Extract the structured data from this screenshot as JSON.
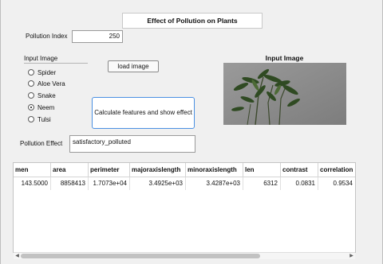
{
  "title": "Effect of Pollution on Plants",
  "pollution_index": {
    "label": "Pollution Index",
    "value": "250"
  },
  "input_image_group": {
    "label": "Input Image",
    "options": [
      {
        "label": "Spider",
        "selected": false
      },
      {
        "label": "Aloe Vera",
        "selected": false
      },
      {
        "label": "Snake",
        "selected": false
      },
      {
        "label": "Neem",
        "selected": true
      },
      {
        "label": "Tulsi",
        "selected": false
      }
    ]
  },
  "load_button": {
    "label": "load image"
  },
  "calc_button": {
    "label": "Calculate features and show effect"
  },
  "image_panel": {
    "title": "Input Image"
  },
  "pollution_effect": {
    "label": "Pollution Effect",
    "value": "satisfactory_polluted"
  },
  "table": {
    "columns": [
      "men",
      "area",
      "perimeter",
      "majoraxislength",
      "minoraxislength",
      "len",
      "contrast",
      "correlation"
    ],
    "rows": [
      [
        "143.5000",
        "8858413",
        "1.7073e+04",
        "3.4925e+03",
        "3.4287e+03",
        "6312",
        "0.0831",
        "0.9534"
      ]
    ]
  },
  "colors": {
    "accent": "#4a90e2",
    "background": "#f0f0f0"
  }
}
